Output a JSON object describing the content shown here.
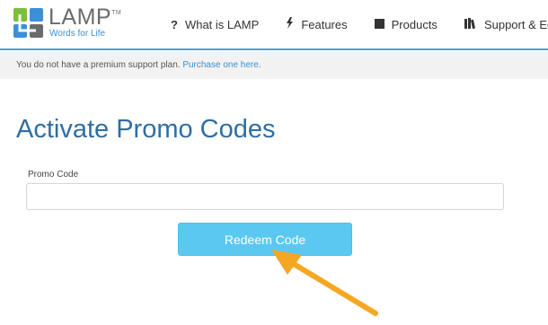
{
  "header": {
    "logo": {
      "name": "LAMP",
      "tm": "TM",
      "tagline": "Words for Life",
      "icon": "lamp-logo-icon"
    },
    "nav": [
      {
        "label": "What is LAMP",
        "icon": "question-icon"
      },
      {
        "label": "Features",
        "icon": "lightning-icon"
      },
      {
        "label": "Products",
        "icon": "device-icon"
      },
      {
        "label": "Support & Ed",
        "icon": "books-icon"
      }
    ]
  },
  "notice": {
    "text": "You do not have a premium support plan.",
    "link_text": "Purchase one here."
  },
  "main": {
    "title": "Activate Promo Codes",
    "promo_label": "Promo Code",
    "promo_value": "",
    "redeem_label": "Redeem Code"
  },
  "annotation": {
    "icon": "orange-arrow-pointer",
    "color": "#f5a623"
  },
  "colors": {
    "accent": "#4a9fd8",
    "title": "#2f6ea3",
    "button": "#5bc8f2",
    "link": "#3a8fd6"
  }
}
